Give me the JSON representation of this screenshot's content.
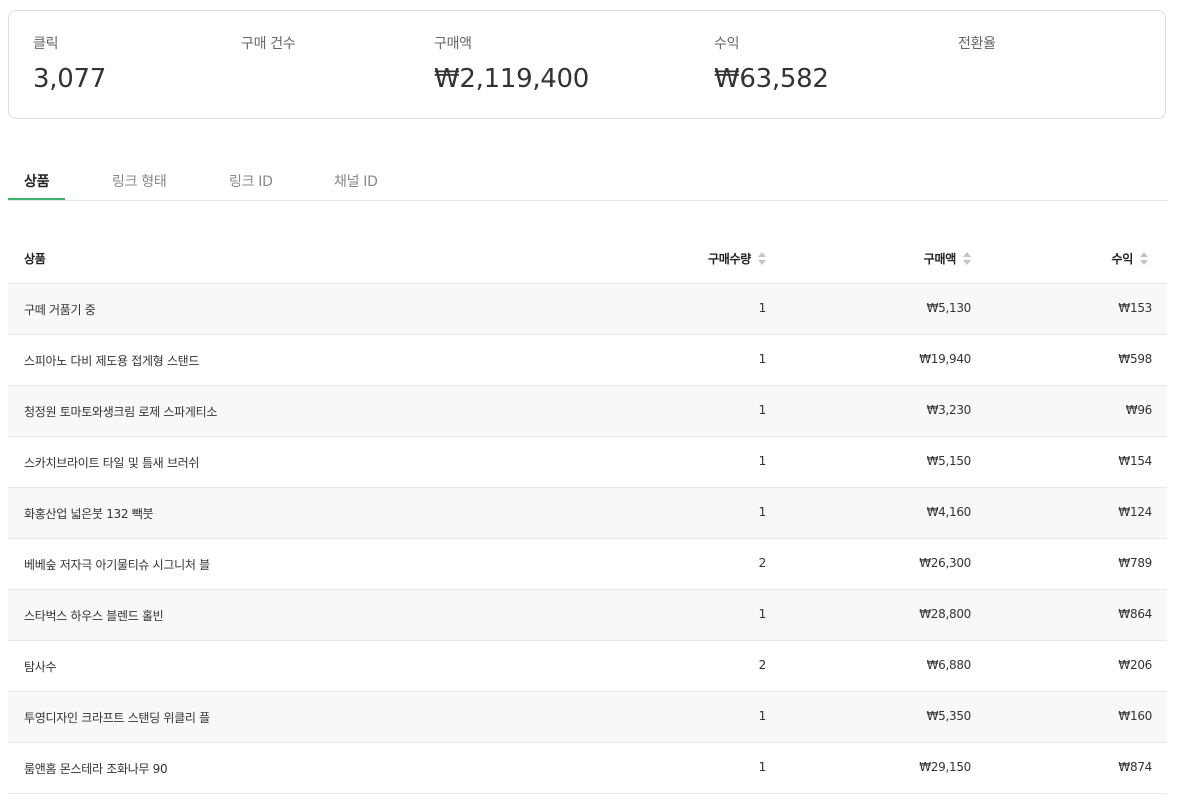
{
  "summary": [
    {
      "label": "클릭",
      "value": "3,077"
    },
    {
      "label": "구매 건수",
      "value": ""
    },
    {
      "label": "구매액",
      "value": "₩2,119,400"
    },
    {
      "label": "수익",
      "value": "₩63,582"
    },
    {
      "label": "전환율",
      "value": ""
    }
  ],
  "tabs": [
    {
      "label": "상품",
      "active": true
    },
    {
      "label": "링크 형태"
    },
    {
      "label": "링크 ID"
    },
    {
      "label": "채널 ID"
    }
  ],
  "table": {
    "headers": {
      "product": "상품",
      "quantity": "구매수량",
      "amount": "구매액",
      "revenue": "수익"
    },
    "rows": [
      {
        "name": "구떼 거품기 중",
        "qty": "1",
        "amount": "₩5,130",
        "revenue": "₩153"
      },
      {
        "name": "스피아노 다비 제도용 접게형 스탠드",
        "qty": "1",
        "amount": "₩19,940",
        "revenue": "₩598"
      },
      {
        "name": "청정원 토마토와생크림 로제 스파게티소",
        "qty": "1",
        "amount": "₩3,230",
        "revenue": "₩96"
      },
      {
        "name": "스카치브라이트 타일 및 틈새 브러쉬",
        "qty": "1",
        "amount": "₩5,150",
        "revenue": "₩154"
      },
      {
        "name": "화홍산업 넓은붓 132 빽붓",
        "qty": "1",
        "amount": "₩4,160",
        "revenue": "₩124"
      },
      {
        "name": "베베숲 저자극 아기물티슈 시그니처 블",
        "qty": "2",
        "amount": "₩26,300",
        "revenue": "₩789"
      },
      {
        "name": "스타벅스 하우스 블렌드 홀빈",
        "qty": "1",
        "amount": "₩28,800",
        "revenue": "₩864"
      },
      {
        "name": "탐사수",
        "qty": "2",
        "amount": "₩6,880",
        "revenue": "₩206"
      },
      {
        "name": "투영디자인 크라프트 스탠딩 위클리 플",
        "qty": "1",
        "amount": "₩5,350",
        "revenue": "₩160"
      },
      {
        "name": "룸앤홈 몬스테라 조화나무 90",
        "qty": "1",
        "amount": "₩29,150",
        "revenue": "₩874"
      }
    ]
  }
}
